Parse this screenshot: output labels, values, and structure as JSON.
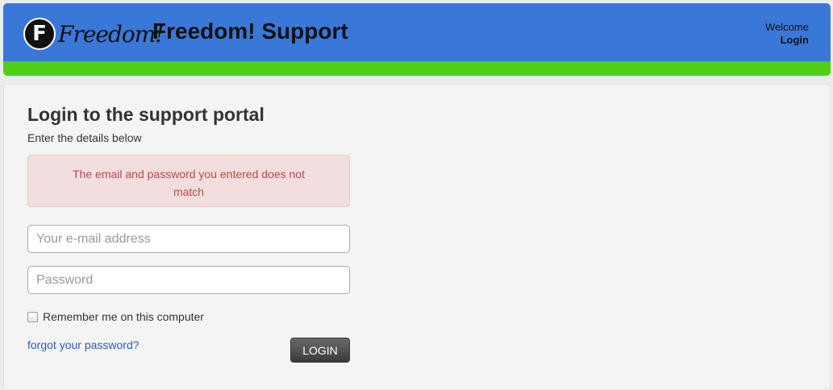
{
  "header": {
    "logo_letter": "F",
    "logo_text": "Freedom!",
    "title": "Freedom! Support",
    "welcome_text": "Welcome",
    "login_link": "Login"
  },
  "colors": {
    "header_blue": "#3a78d8",
    "accent_green": "#4fcf18",
    "error_text": "#b94a48",
    "error_bg": "#f2dede",
    "link_blue": "#2a5db0"
  },
  "main": {
    "heading": "Login to the support portal",
    "subheading": "Enter the details below",
    "error_message": "The email and password you entered does not match"
  },
  "form": {
    "email_placeholder": "Your e-mail address",
    "email_value": "",
    "password_placeholder": "Password",
    "password_value": "",
    "remember_label": "Remember me on this computer",
    "remember_checked": false,
    "forgot_link": "forgot your password?",
    "login_button": "LOGIN"
  },
  "icons": {
    "logo": "freedom-logo-icon",
    "checkbox": "checkbox-icon"
  }
}
